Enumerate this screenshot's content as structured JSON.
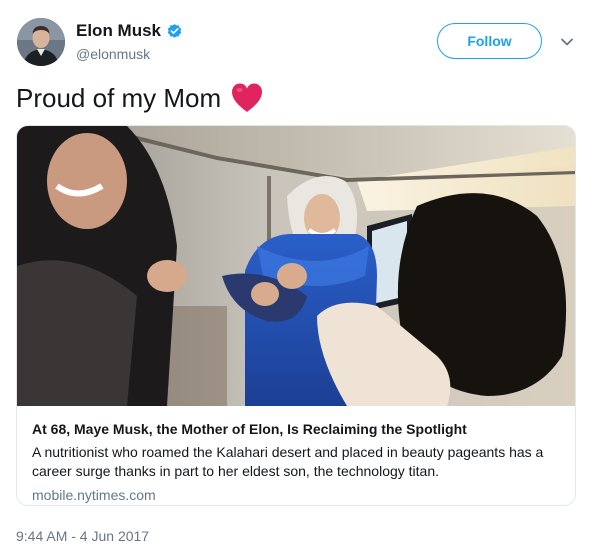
{
  "author": {
    "display_name": "Elon Musk",
    "handle": "@elonmusk",
    "verified": true
  },
  "actions": {
    "follow_label": "Follow"
  },
  "tweet": {
    "text": "Proud of my Mom",
    "emoji": "heart-icon",
    "timestamp": "9:44 AM - 4 Jun 2017"
  },
  "card": {
    "title": "At 68, Maye Musk, the Mother of Elon, Is Reclaiming the Spotlight",
    "description": "A nutritionist who roamed the Kalahari desert and placed in beauty pageants has a career surge thanks in part to her eldest son, the technology titan.",
    "domain": "mobile.nytimes.com"
  },
  "colors": {
    "accent": "#1da1f2",
    "heart": "#e0245e",
    "secondary_text": "#657786",
    "border": "#e1e8ed"
  }
}
